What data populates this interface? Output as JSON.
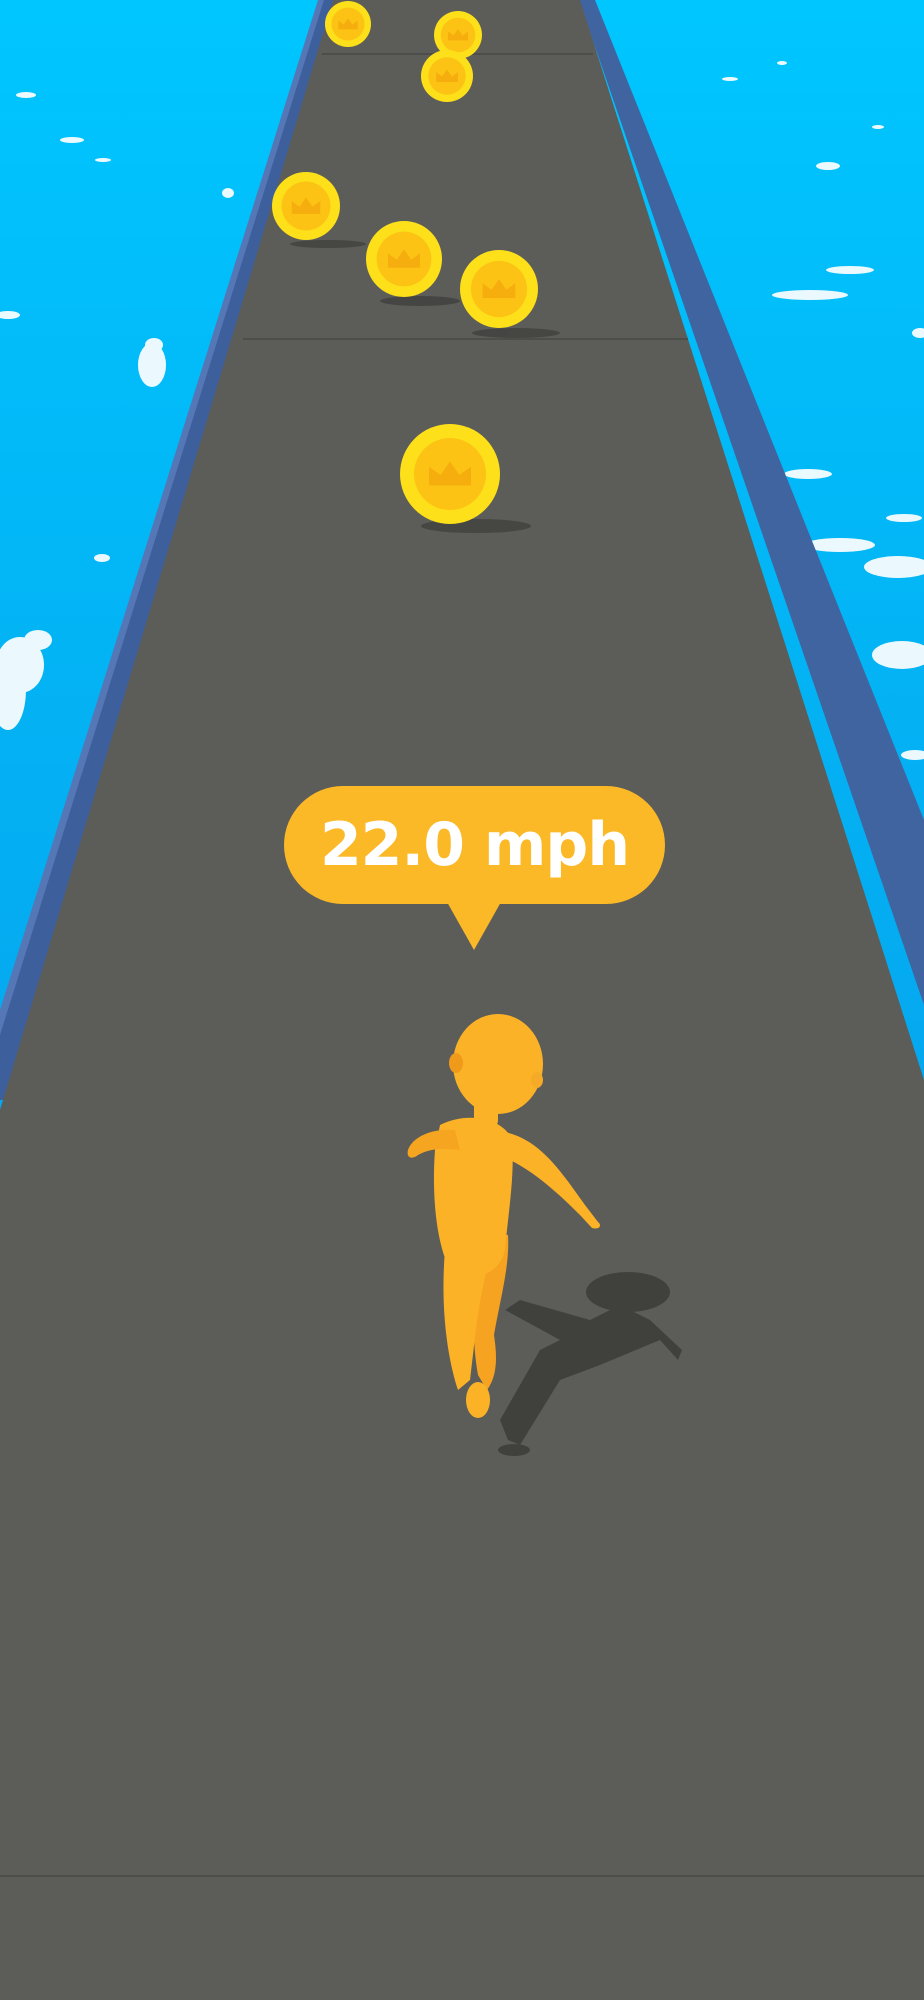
{
  "hud": {
    "speed_label": "22.0 mph"
  },
  "colors": {
    "sky": "#0ab6f2",
    "road": "#5c5d58",
    "rail": "#3f64a0",
    "coin": "#fdd017",
    "player": "#fbb227",
    "bubble": "#fbb827"
  },
  "icons": {
    "coin": "crown-coin-icon",
    "player": "runner-character"
  }
}
